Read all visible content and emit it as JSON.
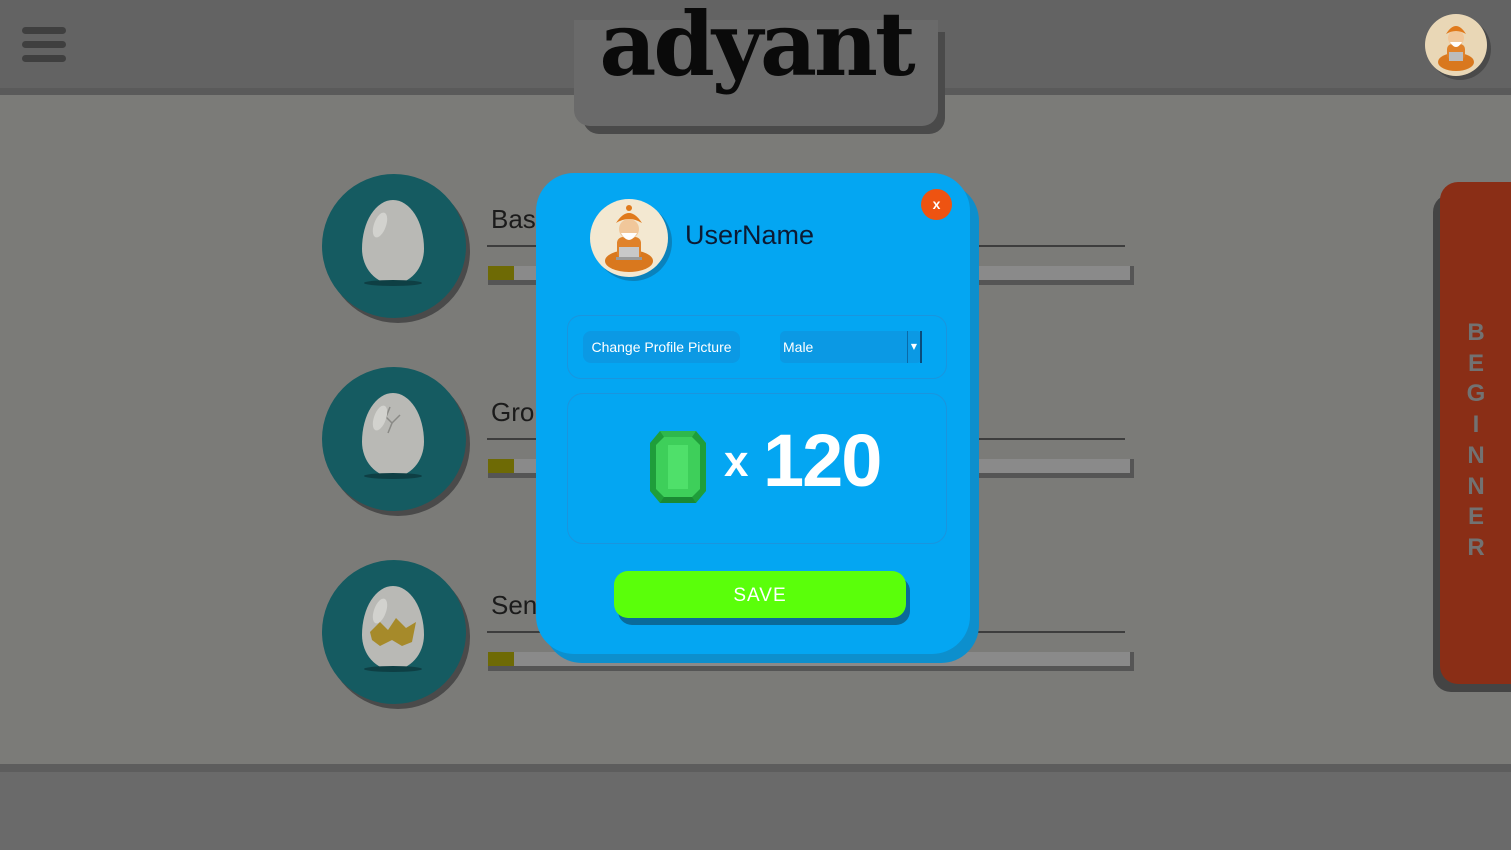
{
  "app": {
    "logo_text": "adyant"
  },
  "levels": [
    {
      "title": "Bas",
      "progress": 0.04
    },
    {
      "title": "Gro",
      "progress": 0.04
    },
    {
      "title": "Sen",
      "progress": 0.04
    }
  ],
  "side_tab": {
    "label": "BEGINNER"
  },
  "profile_modal": {
    "username": "UserName",
    "close_label": "x",
    "change_picture_label": "Change Profile Picture",
    "gender_selected": "Male",
    "gem_multiplier": "x",
    "gem_count": "120",
    "save_label": "SAVE"
  },
  "colors": {
    "modal_bg": "#04a6f2",
    "save_green": "#5aff0a",
    "close_orange": "#ee5311",
    "gem_green": "#3ecf5a",
    "beginner_red": "#8a2e16"
  },
  "icons": {
    "menu": "hamburger-icon",
    "avatar": "guru-avatar-icon",
    "gem": "emerald-gem-icon",
    "egg": "egg-icon"
  }
}
